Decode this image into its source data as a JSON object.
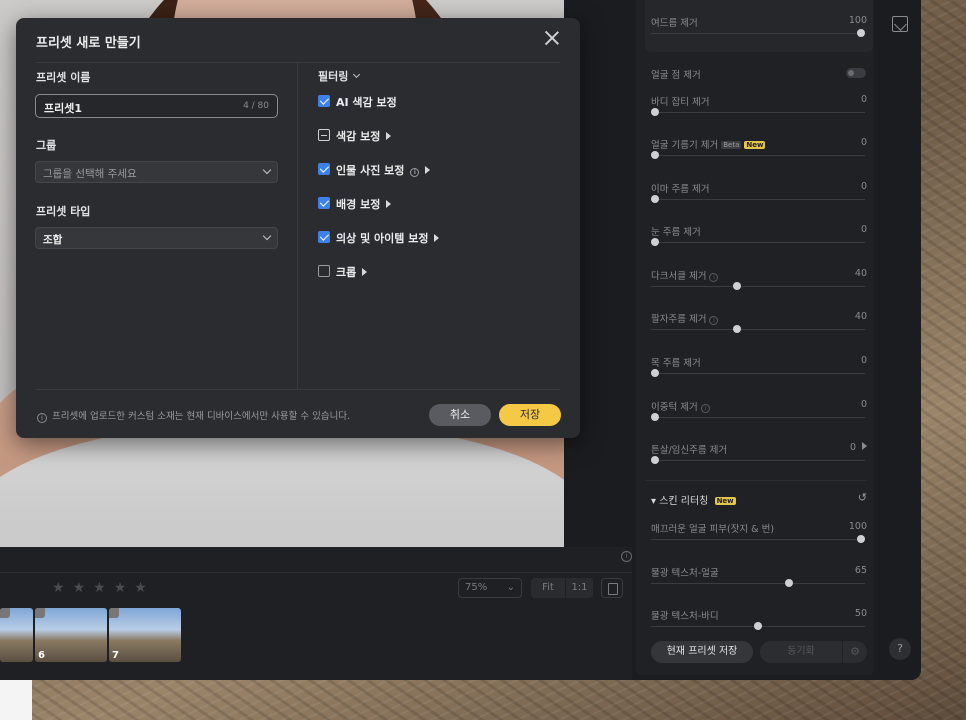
{
  "modal": {
    "title": "프리셋 새로 만들기",
    "name_label": "프리셋 이름",
    "name_value": "프리셋1",
    "name_counter": "4 / 80",
    "group_label": "그룹",
    "group_placeholder": "그룹을 선택해 주세요",
    "type_label": "프리셋 타입",
    "type_value": "조합",
    "filter_label": "필터링",
    "options": [
      {
        "label": "AI 색감 보정",
        "state": "checked",
        "arrow": false,
        "info": false
      },
      {
        "label": "색감 보정",
        "state": "partial",
        "arrow": true,
        "info": false
      },
      {
        "label": "인물 사진 보정",
        "state": "checked",
        "arrow": true,
        "info": true
      },
      {
        "label": "배경 보정",
        "state": "checked",
        "arrow": true,
        "info": false
      },
      {
        "label": "의상 및 아이템 보정",
        "state": "checked",
        "arrow": true,
        "info": false
      },
      {
        "label": "크롭",
        "state": "unchecked",
        "arrow": true,
        "info": false
      }
    ],
    "footer_note": "프리셋에 업로드한 커스텀 소재는 현재 디바이스에서만 사용할 수 있습니다.",
    "cancel_label": "취소",
    "save_label": "저장"
  },
  "filmstrip": {
    "zoom": "75%",
    "fit_label": "Fit",
    "one_to_one_label": "1:1",
    "thumb_numbers": [
      "6",
      "7"
    ],
    "stars": [
      "★",
      "★",
      "★",
      "★",
      "★"
    ]
  },
  "panel": {
    "rows": [
      {
        "label": "여드름 제거",
        "value": "100",
        "level": 100
      },
      {
        "label": "얼굴 점 제거",
        "toggle": true
      },
      {
        "label": "바디 잡티 제거",
        "value": "0",
        "level": 0
      },
      {
        "label": "얼굴 기름기 제거",
        "value": "0",
        "level": 0,
        "beta": "Beta",
        "new": "New"
      },
      {
        "label": "이마 주름 제거",
        "value": "0",
        "level": 0
      },
      {
        "label": "눈 주름 제거",
        "value": "0",
        "level": 0
      },
      {
        "label": "다크서클 제거",
        "value": "40",
        "level": 40,
        "info": true
      },
      {
        "label": "팔자주름 제거",
        "value": "40",
        "level": 40,
        "info": true
      },
      {
        "label": "목 주름 제거",
        "value": "0",
        "level": 0
      },
      {
        "label": "이중턱 제거",
        "value": "0",
        "level": 0,
        "info": true
      },
      {
        "label": "튼살/임신주름 제거",
        "value": "0",
        "level": 0,
        "arrow": true
      }
    ],
    "section_title": "스킨 리터칭",
    "section_new": "New",
    "skin_rows": [
      {
        "label": "매끄러운 얼굴 피부(잣지 & 번)",
        "value": "100",
        "level": 100
      },
      {
        "label": "물광 텍스처-얼굴",
        "value": "65",
        "level": 65
      },
      {
        "label": "물광 텍스처-바디",
        "value": "50",
        "level": 50
      }
    ],
    "save_preset_label": "현재 프리셋 저장",
    "sync_label": "동기화"
  }
}
